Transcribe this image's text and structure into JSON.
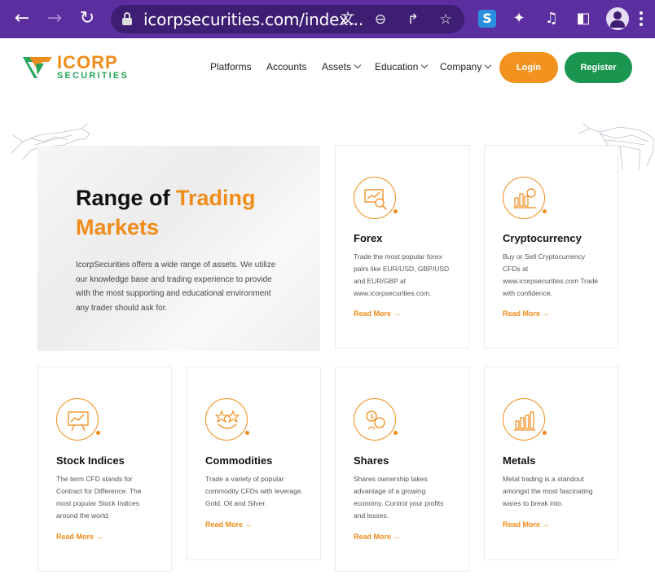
{
  "browser": {
    "url": "icorpsecurities.com/index...",
    "back_icon": "←",
    "forward_icon": "→",
    "reload_icon": "↻",
    "ext_s_label": "S"
  },
  "brand": {
    "name_top": "ICORP",
    "name_bottom": "SECURITIES",
    "accent": "#f08c1a",
    "green": "#1a9650"
  },
  "nav": {
    "items": [
      "Platforms",
      "Accounts",
      "Assets",
      "Education",
      "Company"
    ],
    "login": "Login",
    "register": "Register"
  },
  "hero": {
    "title_part1": "Range of ",
    "title_part2": "Trading",
    "title_part3": "Markets",
    "text": "IcorpSecurities offers a wide range of assets. We utilize our knowledge base and trading experience to provide with the most supporting and educational environment any trader should ask for."
  },
  "cards": [
    {
      "title": "Forex",
      "text": "Trade the most popular forex pairs like EUR/USD, GBP/USD and EUR/GBP at www.icorpsecurities.com.",
      "more": "Read More →",
      "icon": "forex-chart-icon"
    },
    {
      "title": "Cryptocurrency",
      "text": "Buy or Sell Cryptocurrency CFDs at www.icorpsecurities.com Trade with confidence.",
      "more": "Read More →",
      "icon": "crypto-icon"
    },
    {
      "title": "Stock Indices",
      "text": "The term CFD stands for Contract for Difference. The most popular Stock Indices around the world.",
      "more": "Read More →",
      "icon": "stock-board-icon"
    },
    {
      "title": "Commodities",
      "text": "Trade a variety of popular commodity CFDs with leverage. Gold, Oil and Silver.",
      "more": "Read More →",
      "icon": "commodities-icon"
    },
    {
      "title": "Shares",
      "text": "Shares ownership takes advantage of a growing economy. Control your profits and losses.",
      "more": "Read More →",
      "icon": "shares-icon"
    },
    {
      "title": "Metals",
      "text": "Metal trading is a standout amongst the most fascinating wares to break into.",
      "more": "Read More →",
      "icon": "metals-bars-icon"
    }
  ]
}
